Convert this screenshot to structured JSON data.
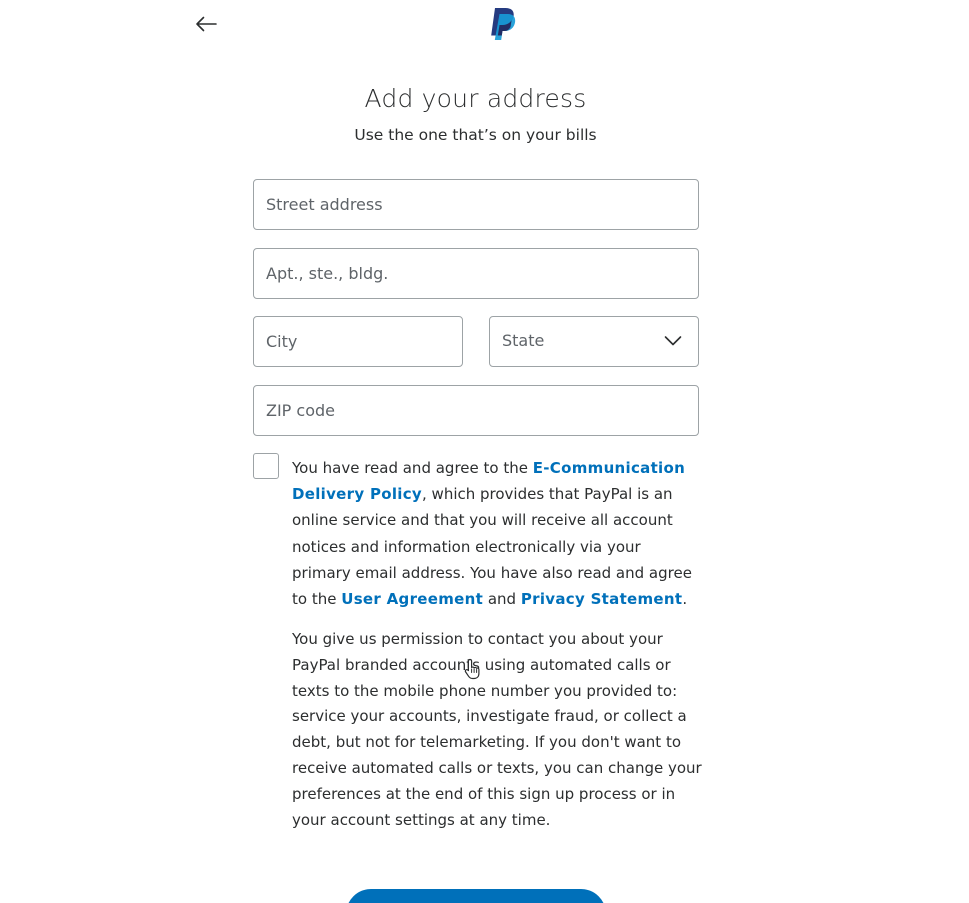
{
  "header": {
    "back_icon": "arrow-left-icon",
    "logo_icon": "paypal-logo-icon"
  },
  "page": {
    "title": "Add your address",
    "subtitle": "Use the one that’s on your bills"
  },
  "form": {
    "street_placeholder": "Street address",
    "apt_placeholder": "Apt., ste., bldg.",
    "city_placeholder": "City",
    "state_label": "State",
    "state_icon": "chevron-down-icon",
    "zip_placeholder": "ZIP code"
  },
  "agreement": {
    "checked": false,
    "text_1": "You have read and agree to the ",
    "link_ecomm": "E-Communication Delivery Policy",
    "text_2": ", which provides that PayPal is an online service and that you will receive all account notices and information electronically via your primary email address. You have also read and agree to the ",
    "link_user_agreement": "User Agreement",
    "text_3": " and ",
    "link_privacy": "Privacy Statement",
    "text_4": "."
  },
  "consent": {
    "text": "You give us permission to contact you about your PayPal branded accounts using automated calls or texts to the mobile phone number you provided to: service your accounts, investigate fraud, or collect a debt, but not for telemarketing. If you don't want to receive automated calls or texts, you can change your preferences at the end of this sign up process or in your account settings at any time."
  },
  "colors": {
    "brand_blue": "#0070ba",
    "text": "#2c2e2f",
    "border": "#9da3a6",
    "logo_dark": "#253b80",
    "logo_light": "#179bd7"
  }
}
